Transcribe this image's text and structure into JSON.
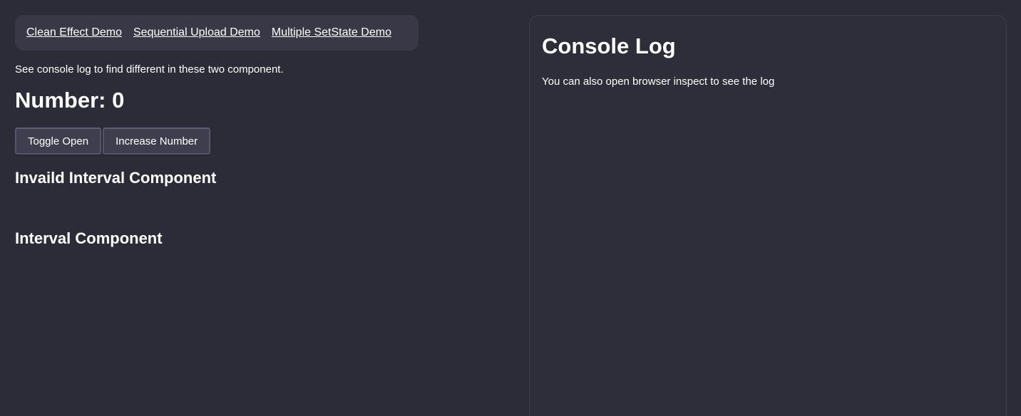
{
  "nav": {
    "links": [
      {
        "label": "Clean Effect Demo"
      },
      {
        "label": "Sequential Upload Demo"
      },
      {
        "label": "Multiple SetState Demo"
      }
    ]
  },
  "main": {
    "hint": "See console log to find different in these two component.",
    "number_heading": "Number: 0",
    "buttons": {
      "toggle_open": "Toggle Open",
      "increase_number": "Increase Number"
    },
    "sections": [
      {
        "title": "Invaild Interval Component"
      },
      {
        "title": "Interval Component"
      }
    ]
  },
  "console": {
    "title": "Console Log",
    "subtitle": "You can also open browser inspect to see the log"
  },
  "colors": {
    "background": "#2c2b38",
    "nav_background": "#393847",
    "button_background": "#3f3e4f",
    "text": "#ffffff"
  }
}
